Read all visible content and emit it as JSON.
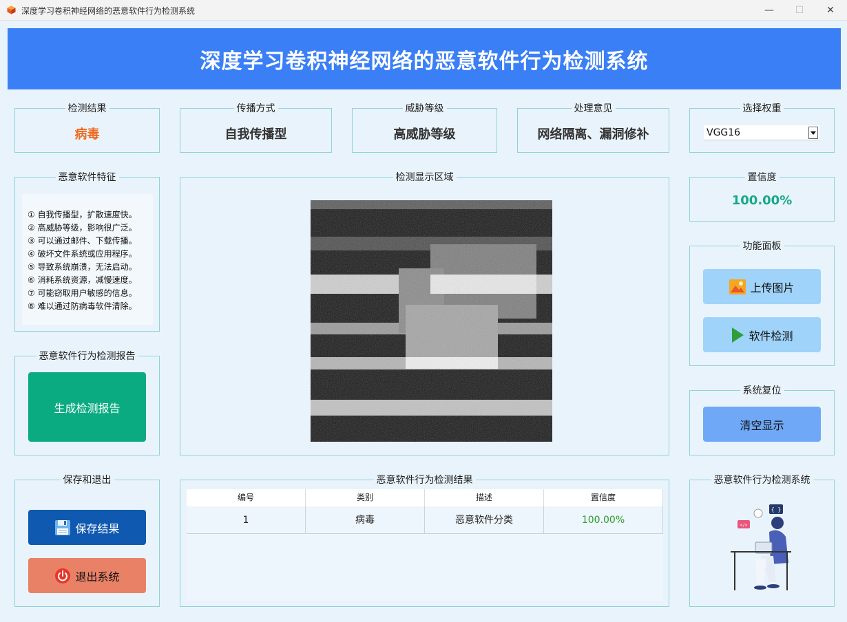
{
  "window": {
    "title": "深度学习卷积神经网络的恶意软件行为检测系统",
    "minimize": "—",
    "maximize": "☐",
    "close": "✕"
  },
  "banner": {
    "title": "深度学习卷积神经网络的恶意软件行为检测系统"
  },
  "top_cards": {
    "result": {
      "label": "检测结果",
      "value": "病毒"
    },
    "spread": {
      "label": "传播方式",
      "value": "自我传播型"
    },
    "threat": {
      "label": "威胁等级",
      "value": "高威胁等级"
    },
    "advice": {
      "label": "处理意见",
      "value": "网络隔离、漏洞修补"
    },
    "weights": {
      "label": "选择权重",
      "selected": "VGG16"
    }
  },
  "features": {
    "label": "恶意软件特征",
    "items": [
      "① 自我传播型，扩散速度快。",
      "② 高威胁等级，影响很广泛。",
      "③ 可以通过邮件、下载传播。",
      "④ 破坏文件系统或应用程序。",
      "⑤ 导致系统崩溃，无法启动。",
      "⑥ 消耗系统资源，减慢速度。",
      "⑦ 可能窃取用户敏感的信息。",
      "⑧ 难以通过防病毒软件清除。"
    ]
  },
  "display": {
    "label": "检测显示区域"
  },
  "confidence": {
    "label": "置信度",
    "value": "100.00%"
  },
  "function_panel": {
    "label": "功能面板",
    "upload": "上传图片",
    "detect": "软件检测"
  },
  "reset": {
    "label": "系统复位",
    "clear": "清空显示"
  },
  "report": {
    "label": "恶意软件行为检测报告",
    "button": "生成检测报告"
  },
  "save_exit": {
    "label": "保存和退出",
    "save": "保存结果",
    "exit": "退出系统"
  },
  "results": {
    "label": "恶意软件行为检测结果",
    "headers": [
      "编号",
      "类别",
      "描述",
      "置信度"
    ],
    "rows": [
      [
        "1",
        "病毒",
        "恶意软件分类",
        "100.00%"
      ]
    ]
  },
  "system_panel": {
    "label": "恶意软件行为检测系统"
  },
  "colors": {
    "banner": "#3a7ff6",
    "accent_orange": "#f06a1e",
    "accent_green": "#15a98a",
    "border": "#8fd3d9"
  }
}
